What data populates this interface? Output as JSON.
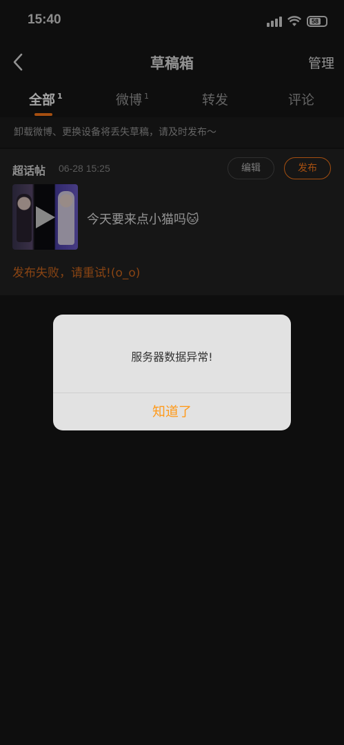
{
  "status_bar": {
    "time": "15:40",
    "battery": "58"
  },
  "nav": {
    "title": "草稿箱",
    "manage": "管理"
  },
  "tabs": [
    {
      "label": "全部",
      "count": "1"
    },
    {
      "label": "微博",
      "count": "1"
    },
    {
      "label": "转发",
      "count": ""
    },
    {
      "label": "评论",
      "count": ""
    }
  ],
  "notice": "卸载微博、更换设备将丢失草稿，请及时发布～",
  "draft": {
    "type": "超话帖",
    "time": "06-28 15:25",
    "edit_label": "编辑",
    "publish_label": "发布",
    "text": "今天要来点小猫吗🐱",
    "error": "发布失败，请重试!(o_o)"
  },
  "alert": {
    "message": "服务器数据异常!",
    "ok_label": "知道了"
  },
  "colors": {
    "accent": "#ff7a1a",
    "error": "#d2691e",
    "alert_ok": "#ff9a1a"
  }
}
